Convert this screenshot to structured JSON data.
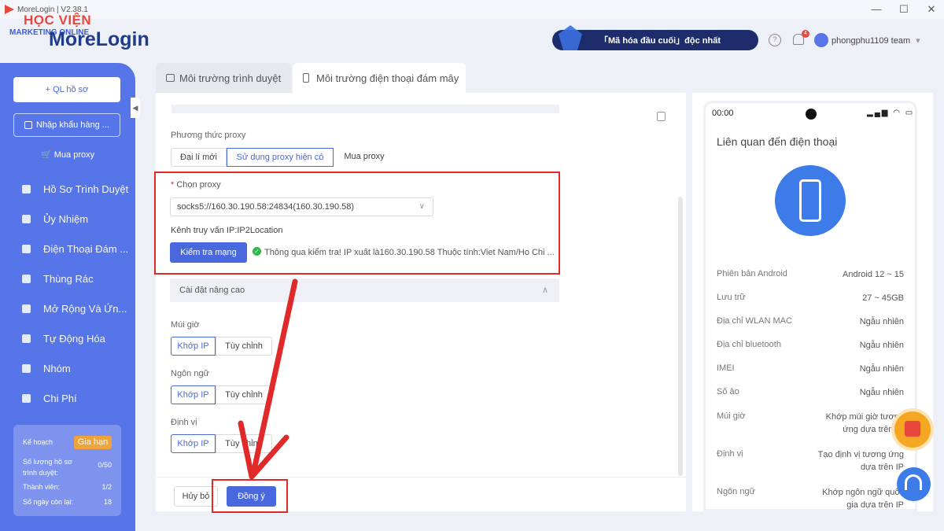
{
  "window": {
    "title": "MoreLogin | V2.38.1",
    "controls": [
      "—",
      "☐",
      "✕"
    ]
  },
  "brand": {
    "hoc_vien": "HỌC VIỆN",
    "marketing": "MARKETING ONLINE",
    "morelogin": "MoreLogin"
  },
  "header": {
    "promo": "「Mã hóa đầu cuối」độc nhất",
    "help_icon": "?",
    "bell_badge": "4",
    "username": "phongphu1109 team",
    "caret": "▾"
  },
  "sidebar": {
    "ql_button": "+ QL hồ sơ",
    "import_button": "Nhập khẩu hàng ...",
    "buy_proxy": "🛒 Mua proxy",
    "items": [
      {
        "label": "Hồ Sơ Trình Duyệt"
      },
      {
        "label": "Ủy Nhiệm"
      },
      {
        "label": "Điện Thoại Đám ..."
      },
      {
        "label": "Thùng Rác"
      },
      {
        "label": "Mở Rộng Và Ứn..."
      },
      {
        "label": "Tự Động Hóa"
      },
      {
        "label": "Nhóm"
      },
      {
        "label": "Chi Phí"
      }
    ],
    "plan": {
      "label": "Kế hoạch",
      "renew": "Gia hạn",
      "rows": [
        {
          "k": "Số lượng hồ sơ trình duyệt:",
          "v": "0/50"
        },
        {
          "k": "Thành viên:",
          "v": "1/2"
        },
        {
          "k": "Số ngày còn lại:",
          "v": "18"
        }
      ]
    }
  },
  "tabs": [
    {
      "label": "Môi trường trình duyệt"
    },
    {
      "label": "Môi trường điện thoại đám mây"
    }
  ],
  "form": {
    "proxy_method_label": "Phương thức proxy",
    "proxy_method_options": [
      "Đại lí mới",
      "Sử dụng proxy hiện có",
      "Mua proxy"
    ],
    "choose_proxy_label": "* Chọn proxy",
    "proxy_value": "socks5://160.30.190.58:24834(160.30.190.58)",
    "query_channel": "Kênh truy vấn IP:IP2Location",
    "check_button": "Kiểm tra mạng",
    "check_ok_icon": "✓",
    "check_message": "Thông qua kiểm tra! IP xuất là160.30.190.58 Thuộc tính:Viet Nam/Ho Chi ...",
    "advanced": "Cài đặt nâng cao",
    "timezone_label": "Múi giờ",
    "language_label": "Ngôn ngữ",
    "location_label": "Định vị",
    "match_ip": "Khớp IP",
    "custom": "Tùy chỉnh",
    "cancel": "Hủy bỏ",
    "ok": "Đồng ý"
  },
  "phone": {
    "time": "00:00",
    "status": "▂▄▆ ◠ ▭",
    "title": "Liên quan đến điện thoại",
    "specs": [
      {
        "k": "Phiên bản Android",
        "v": "Android 12 ~ 15"
      },
      {
        "k": "Lưu trữ",
        "v": "27 ~ 45GB"
      },
      {
        "k": "Địa chỉ WLAN MAC",
        "v": "Ngẫu nhiên"
      },
      {
        "k": "Địa chỉ bluetooth",
        "v": "Ngẫu nhiên"
      },
      {
        "k": "IMEI",
        "v": "Ngẫu nhiên"
      },
      {
        "k": "Số ảo",
        "v": "Ngẫu nhiên"
      },
      {
        "k": "Múi giờ",
        "v": "Khớp múi giờ tương ứng dựa trên IP"
      },
      {
        "k": "Định vị",
        "v": "Tạo định vị tương ứng dựa trên IP"
      },
      {
        "k": "Ngôn ngữ",
        "v": "Khớp ngôn ngữ quốc gia dựa trên IP"
      }
    ]
  },
  "colors": {
    "accent": "#4a68de",
    "sidebar": "#5675e8",
    "annotation": "#e02a2a",
    "success": "#2eb84a"
  }
}
